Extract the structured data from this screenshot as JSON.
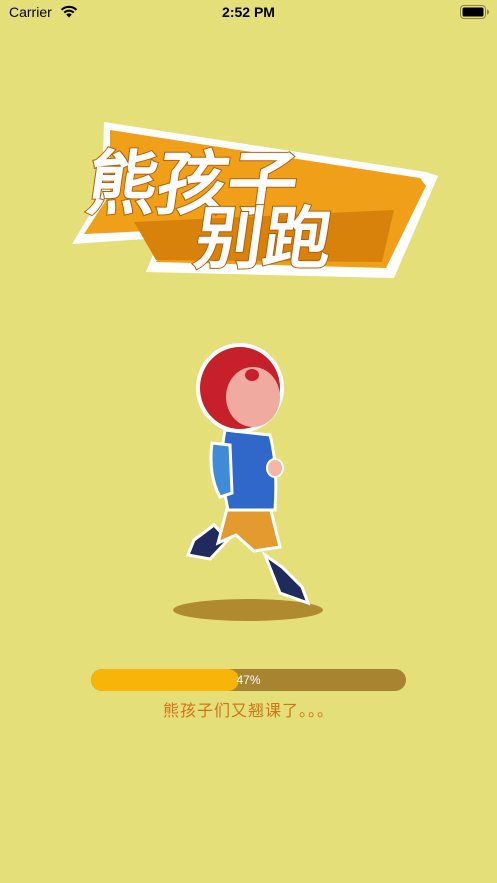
{
  "status_bar": {
    "carrier": "Carrier",
    "time": "2:52 PM",
    "icons": [
      "wifi-icon",
      "battery-icon"
    ]
  },
  "logo": {
    "line1": "熊孩子",
    "line2": "别跑",
    "colors": {
      "primary": "#f0a018",
      "dark": "#b65d06",
      "text": "#ffffff"
    }
  },
  "loading": {
    "progress_label": "47%",
    "progress_value": 0.47,
    "message": "熊孩子们又翘课了。。。"
  },
  "colors": {
    "background": "#e5df79",
    "progress_track": "#a7842f",
    "progress_fill": "#f9b40a",
    "message": "#d0731a"
  }
}
